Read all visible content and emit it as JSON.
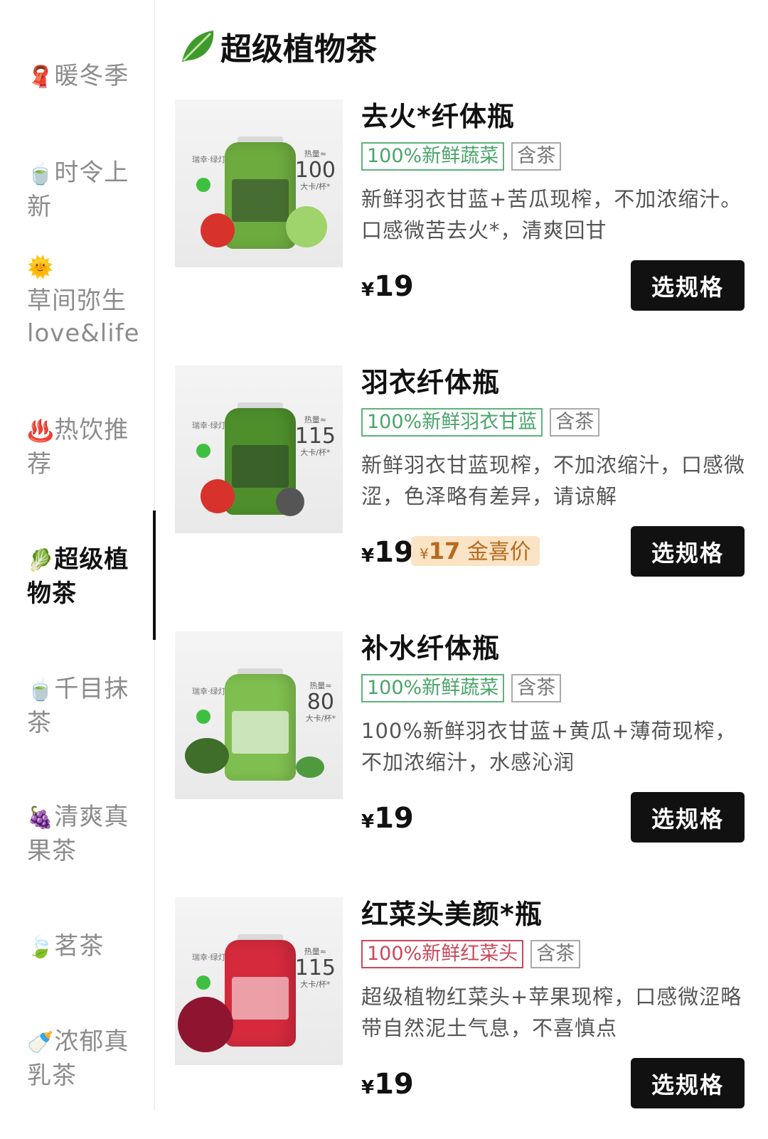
{
  "sidebar": {
    "items": [
      {
        "emoji": "🧣",
        "label": "暖冬季",
        "sub": ""
      },
      {
        "emoji": "🍵",
        "label": "时令上",
        "sub": "新"
      },
      {
        "emoji": "🌞",
        "label": "草间弥生",
        "sub": "love&life"
      },
      {
        "emoji": "♨️",
        "label": "热饮推",
        "sub": "荐"
      },
      {
        "emoji": "🥬",
        "label": "超级植",
        "sub": "物茶"
      },
      {
        "emoji": "🍵",
        "label": "千目抹",
        "sub": "茶"
      },
      {
        "emoji": "🍇",
        "label": "清爽真",
        "sub": "果茶"
      },
      {
        "emoji": "🍃",
        "label": "茗茶",
        "sub": ""
      },
      {
        "emoji": "🍼",
        "label": "浓郁真",
        "sub": "乳茶"
      }
    ],
    "active_index": 4
  },
  "category": {
    "title": "超级植物茶",
    "icon": "leafy-green-icon"
  },
  "products": [
    {
      "name": "去火*纤体瓶",
      "tag_main": "100%新鲜蔬菜",
      "tag_main_color": "green",
      "tag_tea": "含茶",
      "desc": "新鲜羽衣甘蓝+苦瓜现榨，不加浓缩汁。口感微苦去火*，清爽回甘",
      "price_symbol": "¥",
      "price": "19",
      "promo": null,
      "button": "选规格",
      "image": {
        "brand": "瑞幸·绿灯",
        "kcal_label": "热量≈",
        "kcal": "100",
        "kcal_unit": "大卡/杯*",
        "bottle_color": "#6dab3f"
      }
    },
    {
      "name": "羽衣纤体瓶",
      "tag_main": "100%新鲜羽衣甘蓝",
      "tag_main_color": "green",
      "tag_tea": "含茶",
      "desc": "新鲜羽衣甘蓝现榨，不加浓缩汁，口感微涩，色泽略有差异，请谅解",
      "price_symbol": "¥",
      "price": "19",
      "promo": {
        "symbol": "¥",
        "price": "17",
        "label": "金喜价"
      },
      "button": "选规格",
      "image": {
        "brand": "瑞幸·绿灯",
        "kcal_label": "热量≈",
        "kcal": "115",
        "kcal_unit": "大卡/杯*",
        "bottle_color": "#4e8f2c"
      }
    },
    {
      "name": "补水纤体瓶",
      "tag_main": "100%新鲜蔬菜",
      "tag_main_color": "green",
      "tag_tea": "含茶",
      "desc": "100%新鲜羽衣甘蓝+黄瓜+薄荷现榨，不加浓缩汁，水感沁润",
      "price_symbol": "¥",
      "price": "19",
      "promo": null,
      "button": "选规格",
      "image": {
        "brand": "瑞幸·绿灯",
        "kcal_label": "热量≈",
        "kcal": "80",
        "kcal_unit": "大卡/杯*",
        "bottle_color": "#7fbf4f"
      }
    },
    {
      "name": "红菜头美颜*瓶",
      "tag_main": "100%新鲜红菜头",
      "tag_main_color": "red",
      "tag_tea": "含茶",
      "desc": "超级植物红菜头+苹果现榨，口感微涩略带自然泥土气息，不喜慎点",
      "price_symbol": "¥",
      "price": "19",
      "promo": null,
      "button": "选规格",
      "image": {
        "brand": "瑞幸·绿灯",
        "kcal_label": "热量≈",
        "kcal": "115",
        "kcal_unit": "大卡/杯*",
        "bottle_color": "#d42a3c"
      }
    }
  ]
}
